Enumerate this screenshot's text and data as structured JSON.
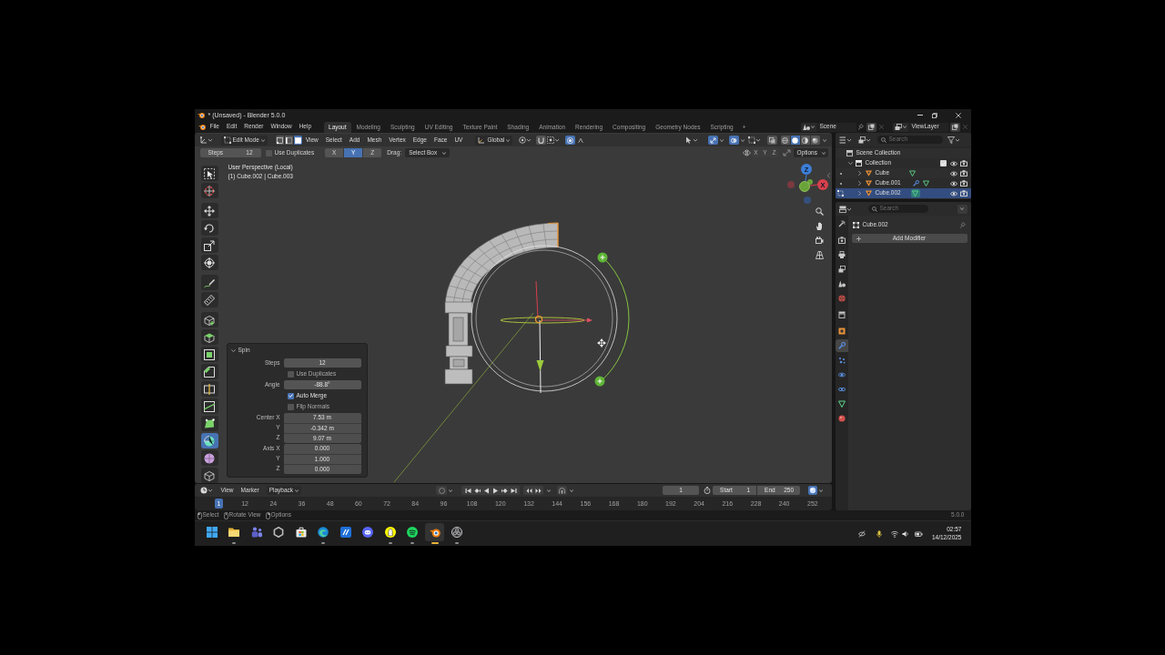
{
  "window": {
    "title": "* (Unsaved) - Blender 5.0.0"
  },
  "menu": [
    "File",
    "Edit",
    "Render",
    "Window",
    "Help"
  ],
  "workspaces": [
    {
      "label": "Layout",
      "selected": true
    },
    {
      "label": "Modeling",
      "selected": false
    },
    {
      "label": "Sculpting",
      "selected": false
    },
    {
      "label": "UV Editing",
      "selected": false
    },
    {
      "label": "Texture Paint",
      "selected": false
    },
    {
      "label": "Shading",
      "selected": false
    },
    {
      "label": "Animation",
      "selected": false
    },
    {
      "label": "Rendering",
      "selected": false
    },
    {
      "label": "Compositing",
      "selected": false
    },
    {
      "label": "Geometry Nodes",
      "selected": false
    },
    {
      "label": "Scripting",
      "selected": false
    }
  ],
  "add_workspace": "+",
  "scene": "Scene",
  "view_layer": "ViewLayer",
  "viewport_header": {
    "mode": "Edit Mode",
    "select_modes": [
      {
        "kind": "vertex",
        "selected": false
      },
      {
        "kind": "edge",
        "selected": false
      },
      {
        "kind": "face",
        "selected": true
      }
    ],
    "menus": [
      "View",
      "Select",
      "Add",
      "Mesh",
      "Vertex",
      "Edge",
      "Face",
      "UV"
    ],
    "orientation": "Global",
    "proportional_editing": true,
    "gizmos": true,
    "overlays": true,
    "shading": [
      {
        "kind": "wireframe",
        "selected": false
      },
      {
        "kind": "solid",
        "selected": true
      },
      {
        "kind": "material",
        "selected": false
      },
      {
        "kind": "rendered",
        "selected": false
      }
    ]
  },
  "tool_settings": {
    "steps": {
      "label": "Steps",
      "value": "12"
    },
    "use_duplicates": {
      "label": "Use Duplicates",
      "checked": false
    },
    "axes": [
      {
        "label": "X",
        "selected": false
      },
      {
        "label": "Y",
        "selected": true
      },
      {
        "label": "Z",
        "selected": false
      }
    ],
    "drag": {
      "label": "Drag:",
      "value": "Select Box"
    },
    "mirror_axes": [
      "X",
      "Y",
      "Z"
    ],
    "options": "Options"
  },
  "viewport": {
    "view_name": "User Perspective (Local)",
    "object_info": "(1) Cube.002 | Cube.003",
    "gizmo_labels": [
      "Z",
      "X"
    ]
  },
  "toolbar": [
    [
      {
        "kind": "select_box",
        "selected": false
      },
      {
        "kind": "cursor",
        "selected": false
      }
    ],
    [
      {
        "kind": "move",
        "selected": false
      },
      {
        "kind": "rotate",
        "selected": false
      },
      {
        "kind": "scale",
        "selected": false
      },
      {
        "kind": "transform",
        "selected": false
      }
    ],
    [
      {
        "kind": "annotate",
        "selected": false
      },
      {
        "kind": "measure",
        "selected": false
      }
    ],
    [
      {
        "kind": "add_cube",
        "selected": false
      },
      {
        "kind": "extrude",
        "selected": false
      },
      {
        "kind": "inset",
        "selected": false
      },
      {
        "kind": "bevel",
        "selected": false
      },
      {
        "kind": "loop_cut",
        "selected": false
      },
      {
        "kind": "knife",
        "selected": false
      },
      {
        "kind": "poly_build",
        "selected": false
      },
      {
        "kind": "spin",
        "selected": true
      },
      {
        "kind": "smooth",
        "selected": false
      },
      {
        "kind": "shrink",
        "selected": false
      }
    ]
  ],
  "spin_panel": {
    "title": "Spin",
    "expanded": true,
    "rows": [
      {
        "kind": "number",
        "label": "Steps",
        "value": "12"
      },
      {
        "kind": "checkbox",
        "label": "Use Duplicates",
        "checked": false
      },
      {
        "kind": "number",
        "label": "Angle",
        "value": "-88.8°"
      },
      {
        "kind": "checkbox",
        "label": "Auto Merge",
        "checked": true
      },
      {
        "kind": "checkbox",
        "label": "Flip Normals",
        "checked": false
      },
      {
        "kind": "vector",
        "fields": [
          {
            "label": "Center X",
            "value": "7.53 m"
          },
          {
            "label": "Y",
            "value": "-0.342 m"
          },
          {
            "label": "Z",
            "value": "9.07 m"
          }
        ]
      },
      {
        "kind": "vector",
        "fields": [
          {
            "label": "Axis X",
            "value": "0.000"
          },
          {
            "label": "Y",
            "value": "1.000"
          },
          {
            "label": "Z",
            "value": "0.000"
          }
        ]
      }
    ]
  },
  "timeline": {
    "menus": [
      {
        "kind": "menu",
        "label": "View"
      },
      {
        "kind": "menu",
        "label": "Marker"
      },
      {
        "kind": "dropdown",
        "label": "Playback"
      }
    ],
    "current_frame": "1",
    "start": {
      "label": "Start",
      "value": "1"
    },
    "end": {
      "label": "End",
      "value": "250"
    },
    "ticks": [
      {
        "label": "1",
        "selected": true
      },
      {
        "label": "12",
        "selected": false
      },
      {
        "label": "24",
        "selected": false
      },
      {
        "label": "36",
        "selected": false
      },
      {
        "label": "48",
        "selected": false
      },
      {
        "label": "60",
        "selected": false
      },
      {
        "label": "72",
        "selected": false
      },
      {
        "label": "84",
        "selected": false
      },
      {
        "label": "96",
        "selected": false
      },
      {
        "label": "108",
        "selected": false
      },
      {
        "label": "120",
        "selected": false
      },
      {
        "label": "132",
        "selected": false
      },
      {
        "label": "144",
        "selected": false
      },
      {
        "label": "156",
        "selected": false
      },
      {
        "label": "168",
        "selected": false
      },
      {
        "label": "180",
        "selected": false
      },
      {
        "label": "192",
        "selected": false
      },
      {
        "label": "204",
        "selected": false
      },
      {
        "label": "216",
        "selected": false
      },
      {
        "label": "228",
        "selected": false
      },
      {
        "label": "240",
        "selected": false
      },
      {
        "label": "252",
        "selected": false
      }
    ]
  },
  "outliner": {
    "search_placeholder": "Search",
    "tree": [
      {
        "kind": "scene_collection",
        "label": "Scene Collection",
        "selected": false,
        "children": [
          {
            "kind": "collection",
            "label": "Collection",
            "selected": false,
            "expanded": true,
            "checked": true,
            "visible": true,
            "render": true,
            "children": [
              {
                "kind": "object",
                "label": "Cube",
                "selected": false,
                "expanded": false,
                "editing": false,
                "has_modifier": false,
                "visible": true,
                "render": true
              },
              {
                "kind": "object",
                "label": "Cube.001",
                "selected": false,
                "expanded": false,
                "editing": false,
                "has_modifier": true,
                "visible": true,
                "render": true
              },
              {
                "kind": "object",
                "label": "Cube.002",
                "selected": true,
                "expanded": false,
                "editing": true,
                "has_modifier": false,
                "visible": true,
                "render": true
              }
            ]
          }
        ]
      }
    ]
  },
  "properties": {
    "search_placeholder": "Search",
    "tabs": [
      [
        {
          "kind": "tool",
          "selected": false
        }
      ],
      [
        {
          "kind": "render",
          "selected": false
        },
        {
          "kind": "output",
          "selected": false
        },
        {
          "kind": "view_layer",
          "selected": false
        },
        {
          "kind": "scene",
          "selected": false
        },
        {
          "kind": "world",
          "selected": false
        }
      ],
      [
        {
          "kind": "collection",
          "selected": false
        }
      ],
      [
        {
          "kind": "object",
          "selected": false
        },
        {
          "kind": "modifiers",
          "selected": true
        },
        {
          "kind": "particles",
          "selected": false
        },
        {
          "kind": "physics",
          "selected": false
        },
        {
          "kind": "constraints",
          "selected": false
        },
        {
          "kind": "data",
          "selected": false
        },
        {
          "kind": "material",
          "selected": false
        }
      ]
    ],
    "object_name": "Cube.002",
    "add_modifier": "Add Modifier"
  },
  "status_bar": {
    "hints": [
      {
        "kind": "left_click",
        "label": "Select"
      },
      {
        "kind": "middle_click",
        "label": "Rotate View"
      },
      {
        "kind": "right_click",
        "label": "Options"
      }
    ],
    "version": "5.0.0"
  },
  "taskbar": {
    "apps": [
      {
        "kind": "start",
        "running": false,
        "selected": false
      },
      {
        "kind": "files",
        "running": true,
        "selected": false
      },
      {
        "kind": "teams",
        "running": false,
        "selected": false
      },
      {
        "kind": "hexagon",
        "running": false,
        "selected": false
      },
      {
        "kind": "store",
        "running": false,
        "selected": false
      },
      {
        "kind": "edge",
        "running": true,
        "selected": false
      },
      {
        "kind": "slash",
        "running": false,
        "selected": false
      },
      {
        "kind": "discord",
        "running": false,
        "selected": false
      },
      {
        "kind": "snapchat",
        "running": true,
        "selected": false
      },
      {
        "kind": "spotify",
        "running": true,
        "selected": false
      },
      {
        "kind": "blender",
        "running": true,
        "selected": true
      },
      {
        "kind": "obs",
        "running": true,
        "selected": false
      }
    ],
    "time": "02:57",
    "date": "14/12/2025"
  }
}
